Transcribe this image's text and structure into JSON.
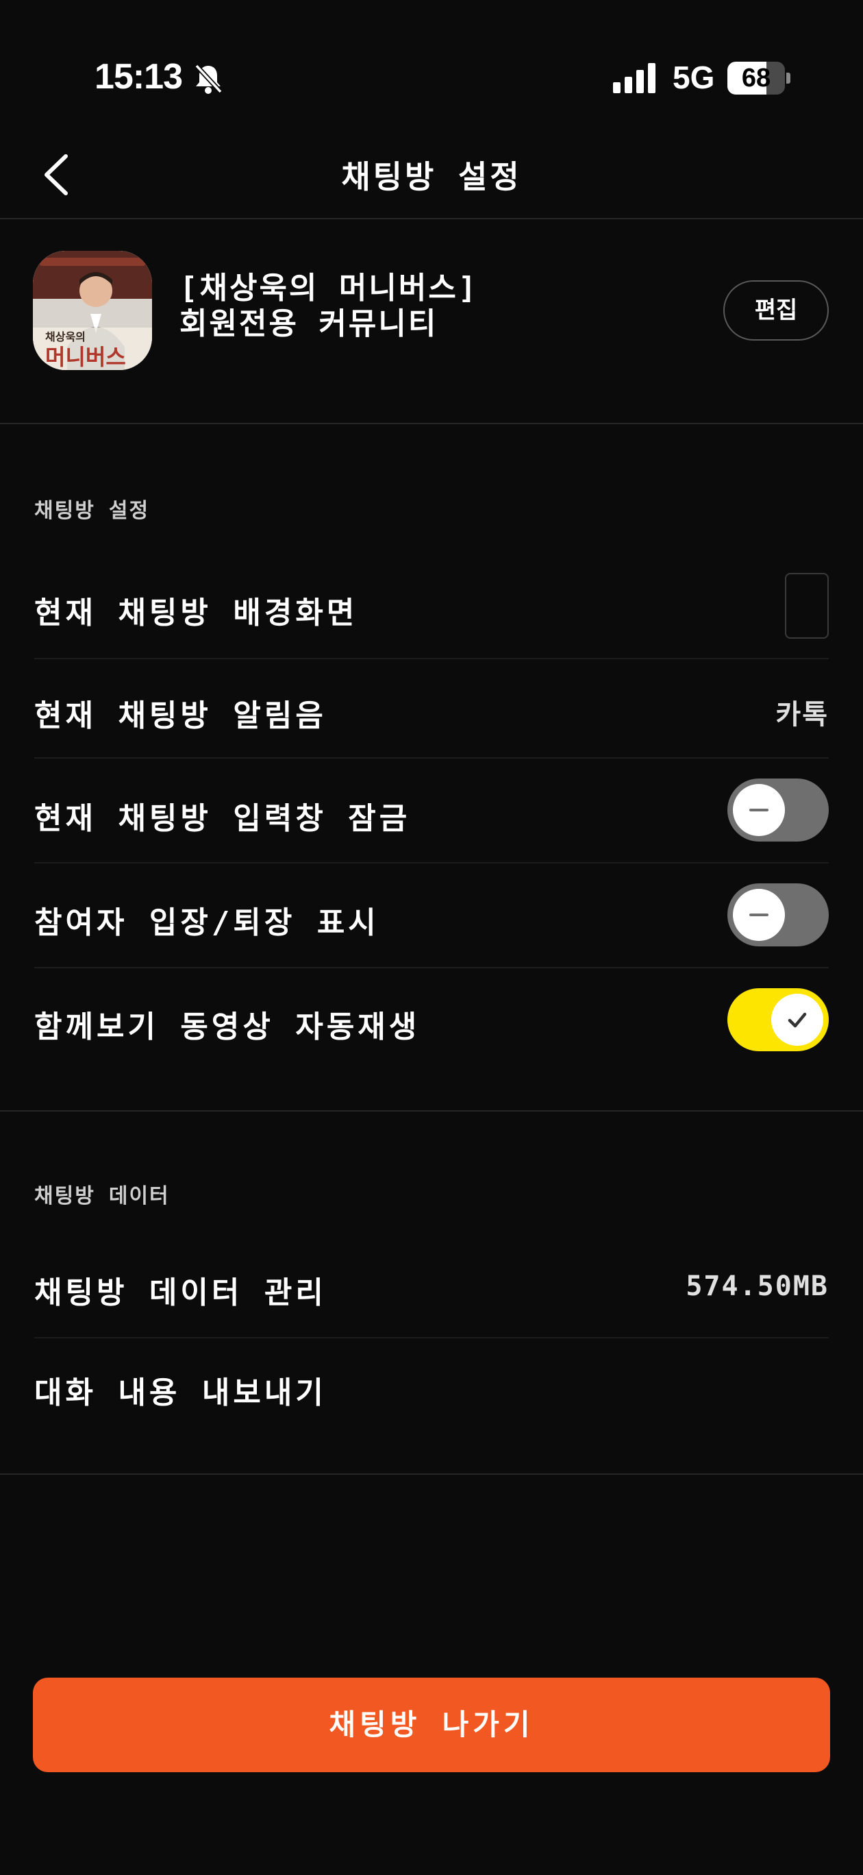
{
  "status_bar": {
    "time": "15:13",
    "network": "5G",
    "battery": "68",
    "battery_level": 0.68,
    "icons": [
      "bell-slash-icon",
      "cellular-signal-icon",
      "battery-icon"
    ]
  },
  "header": {
    "title": "채팅방 설정",
    "back_icon": "chevron-left-icon"
  },
  "room": {
    "name_line1": "[채상욱의 머니버스]",
    "name_line2": "회원전용 커뮤니티",
    "edit_label": "편집",
    "avatar_caption": "머니버스",
    "avatar_subcaption": "채상욱의"
  },
  "settings_section": {
    "label": "채팅방 설정",
    "items": [
      {
        "label": "현재 채팅방 배경화면",
        "control": "preview"
      },
      {
        "label": "현재 채팅방 알림음",
        "value": "카톡"
      },
      {
        "label": "현재 채팅방 입력창 잠금",
        "toggle": false
      },
      {
        "label": "참여자 입장/퇴장 표시",
        "toggle": false
      },
      {
        "label": "함께보기 동영상 자동재생",
        "toggle": true
      }
    ]
  },
  "data_section": {
    "label": "채팅방 데이터",
    "items": [
      {
        "label": "채팅방 데이터 관리",
        "value": "574.50MB"
      },
      {
        "label": "대화 내용 내보내기"
      }
    ]
  },
  "leave_button": {
    "label": "채팅방 나가기"
  },
  "colors": {
    "background": "#0b0b0b",
    "toggle_on": "#fee500",
    "toggle_off": "#6f6f6f",
    "leave_button": "#f25821"
  }
}
